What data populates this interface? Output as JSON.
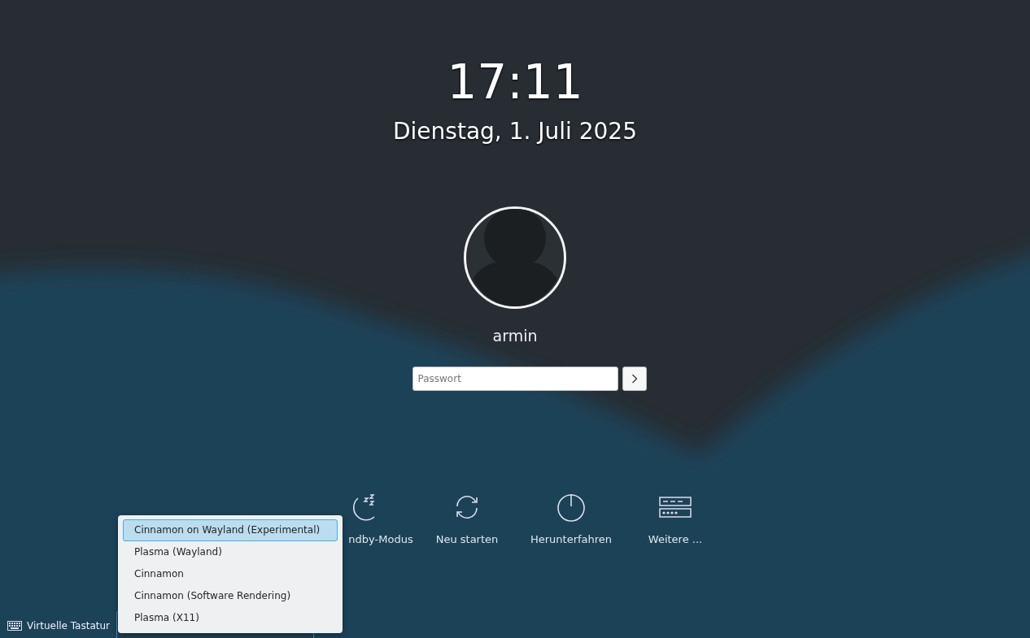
{
  "clock": {
    "time": "17:11",
    "date": "Dienstag, 1. Juli 2025"
  },
  "user": {
    "name": "armin"
  },
  "password": {
    "placeholder": "Passwort"
  },
  "actions": [
    {
      "kind": "sleep",
      "label": "ndby-Modus"
    },
    {
      "kind": "restart",
      "label": "Neu starten"
    },
    {
      "kind": "shutdown",
      "label": "Herunterfahren"
    },
    {
      "kind": "more",
      "label": "Weitere ..."
    }
  ],
  "bottom_bar": {
    "virtual_keyboard": "Virtuelle Tastatur"
  },
  "session_menu": {
    "items": [
      {
        "label": "Cinnamon on Wayland (Experimental)",
        "selected": true
      },
      {
        "label": "Plasma (Wayland)",
        "selected": false
      },
      {
        "label": "Cinnamon",
        "selected": false
      },
      {
        "label": "Cinnamon (Software Rendering)",
        "selected": false
      },
      {
        "label": "Plasma (X11)",
        "selected": false
      }
    ]
  }
}
